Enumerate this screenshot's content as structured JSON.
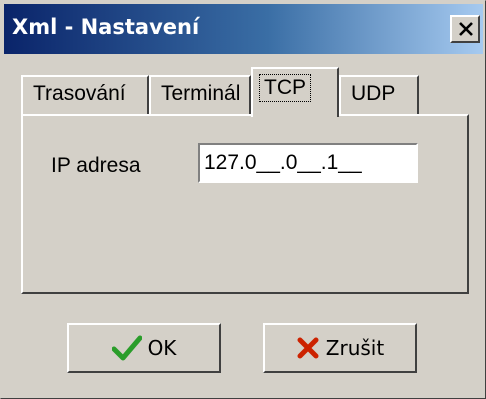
{
  "window": {
    "title": "Xml - Nastavení",
    "close_icon": "close-icon"
  },
  "tabs": [
    {
      "label": "Trasování",
      "active": false
    },
    {
      "label": "Terminál",
      "active": false
    },
    {
      "label": "TCP",
      "active": true
    },
    {
      "label": "UDP",
      "active": false
    }
  ],
  "tcp": {
    "ip_label": "IP adresa",
    "ip_value": "127.0__.0__.1__"
  },
  "buttons": {
    "ok_label": "OK",
    "ok_icon": "checkmark-icon",
    "cancel_label": "Zrušit",
    "cancel_icon": "cross-icon"
  },
  "colors": {
    "title_gradient_start": "#0a246a",
    "title_gradient_end": "#a6caf0",
    "face": "#d4d0c8",
    "ok_check": "#2a9d2a",
    "cancel_cross": "#cc2200"
  }
}
